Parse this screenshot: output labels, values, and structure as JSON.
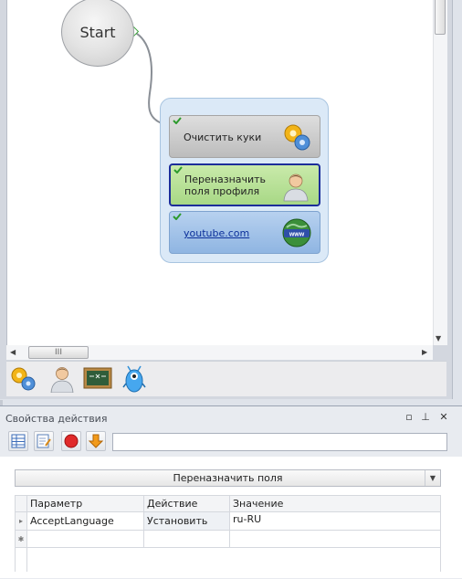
{
  "canvas": {
    "start_label": "Start",
    "actions": [
      {
        "label": "Очистить куки"
      },
      {
        "label_line1": "Переназначить",
        "label_line2": "поля профиля"
      },
      {
        "label": "youtube.com"
      }
    ],
    "hscroll_grip": "III"
  },
  "toolbar_icons": [
    "gears-icon",
    "user-icon",
    "chalkboard-icon",
    "robot-icon"
  ],
  "properties": {
    "title": "Свойства действия",
    "input_value": "",
    "dropdown_value": "Переназначить поля",
    "table": {
      "headers": [
        "Параметр",
        "Действие",
        "Значение"
      ],
      "rows": [
        {
          "param": "AcceptLanguage",
          "action": "Установить",
          "value": "ru-RU"
        }
      ]
    }
  },
  "colors": {
    "group_bg": "#dbe9f7",
    "profile_action": "#a8d886",
    "youtube_action": "#8fb5e2",
    "selected_border": "#1c2d9a"
  }
}
